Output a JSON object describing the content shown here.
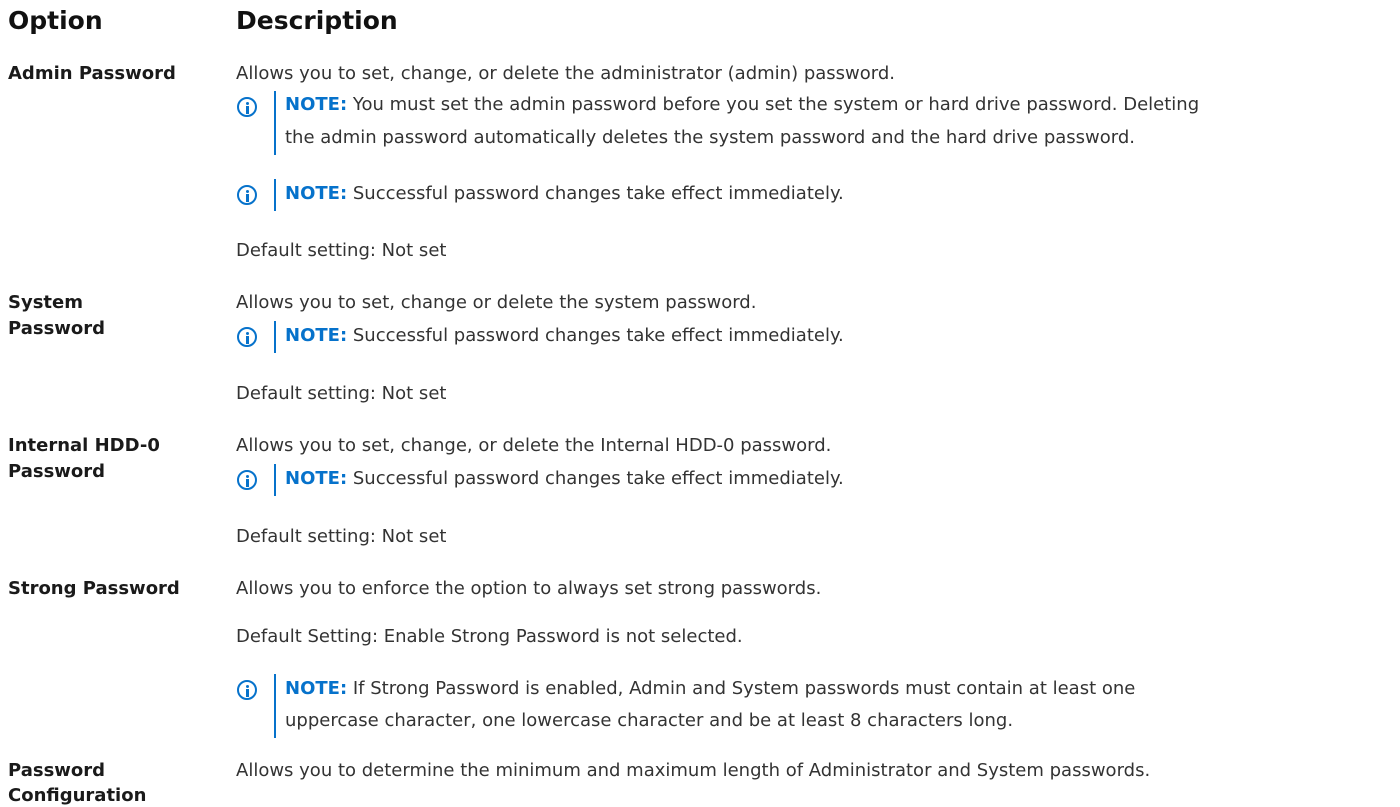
{
  "header": {
    "option": "Option",
    "description": "Description"
  },
  "note_label": "NOTE:",
  "rows": [
    {
      "option": "Admin Password",
      "description": "Allows you to set, change, or delete the administrator (admin) password.",
      "notes": [
        {
          "line1": "You must set the admin password before you set the system or hard drive password. Deleting",
          "line2": "the admin password automatically deletes the system password and the hard drive password."
        },
        {
          "line1": "Successful password changes take effect immediately."
        }
      ],
      "default": "Default setting: Not set"
    },
    {
      "option_line1": "System",
      "option_line2": "Password",
      "description": "Allows you to set, change or delete the system password.",
      "notes": [
        {
          "line1": "Successful password changes take effect immediately."
        }
      ],
      "default": "Default setting: Not set"
    },
    {
      "option_line1": "Internal HDD-0",
      "option_line2": "Password",
      "description": "Allows you to set, change, or delete the Internal HDD-0 password.",
      "notes": [
        {
          "line1": "Successful password changes take effect immediately."
        }
      ],
      "default": "Default setting: Not set"
    },
    {
      "option": "Strong Password",
      "description": "Allows you to enforce the option to always set strong passwords.",
      "default": "Default Setting: Enable Strong Password is not selected.",
      "notes": [
        {
          "line1": "If Strong Password is enabled, Admin and System passwords must contain at least one",
          "line2": "uppercase character, one lowercase character and be at least 8 characters long."
        }
      ]
    },
    {
      "option_line1": "Password",
      "option_line2": "Configuration",
      "description": "Allows you to determine the minimum and maximum length of Administrator and System passwords."
    }
  ]
}
